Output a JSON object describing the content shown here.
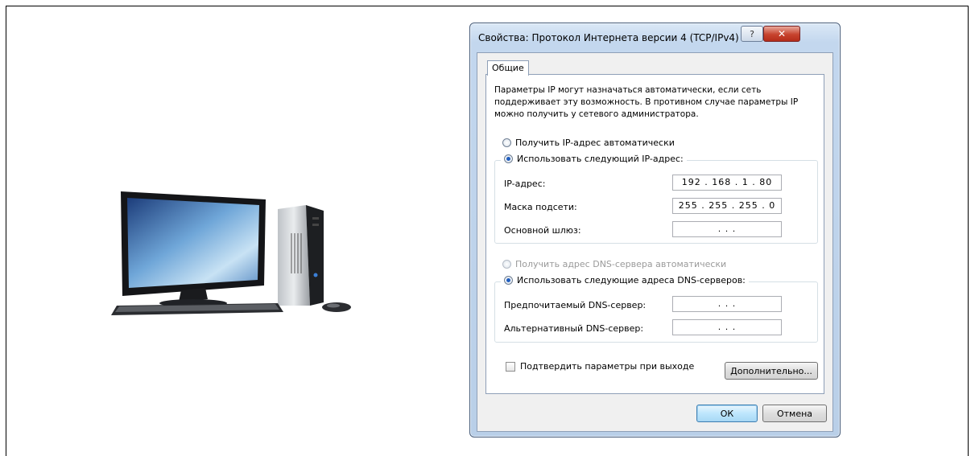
{
  "dialog": {
    "title": "Свойства: Протокол Интернета версии 4 (TCP/IPv4)",
    "help_label": "?",
    "close_label": "✕",
    "tab_general": "Общие",
    "description": "Параметры IP могут назначаться автоматически, если сеть поддерживает эту возможность. В противном случае параметры IP можно получить у сетевого администратора.",
    "ip_auto_label": "Получить IP-адрес автоматически",
    "ip_manual_label": "Использовать следующий IP-адрес:",
    "ip_address_label": "IP-адрес:",
    "ip_address_value": "192 . 168 .  1  . 80",
    "subnet_label": "Маска подсети:",
    "subnet_value": "255 . 255 . 255 .  0",
    "gateway_label": "Основной шлюз:",
    "gateway_value": ".      .      .",
    "dns_auto_label": "Получить адрес DNS-сервера автоматически",
    "dns_manual_label": "Использовать следующие адреса DNS-серверов:",
    "dns_preferred_label": "Предпочитаемый DNS-сервер:",
    "dns_preferred_value": ".      .      .",
    "dns_alternate_label": "Альтернативный DNS-сервер:",
    "dns_alternate_value": ".      .      .",
    "validate_label": "Подтвердить параметры при выходе",
    "advanced_label": "Дополнительно...",
    "ok_label": "ОК",
    "cancel_label": "Отмена",
    "ip_mode": "manual",
    "dns_mode": "manual",
    "validate_checked": false
  },
  "illustration": {
    "icon": "desktop-computer-icon"
  }
}
